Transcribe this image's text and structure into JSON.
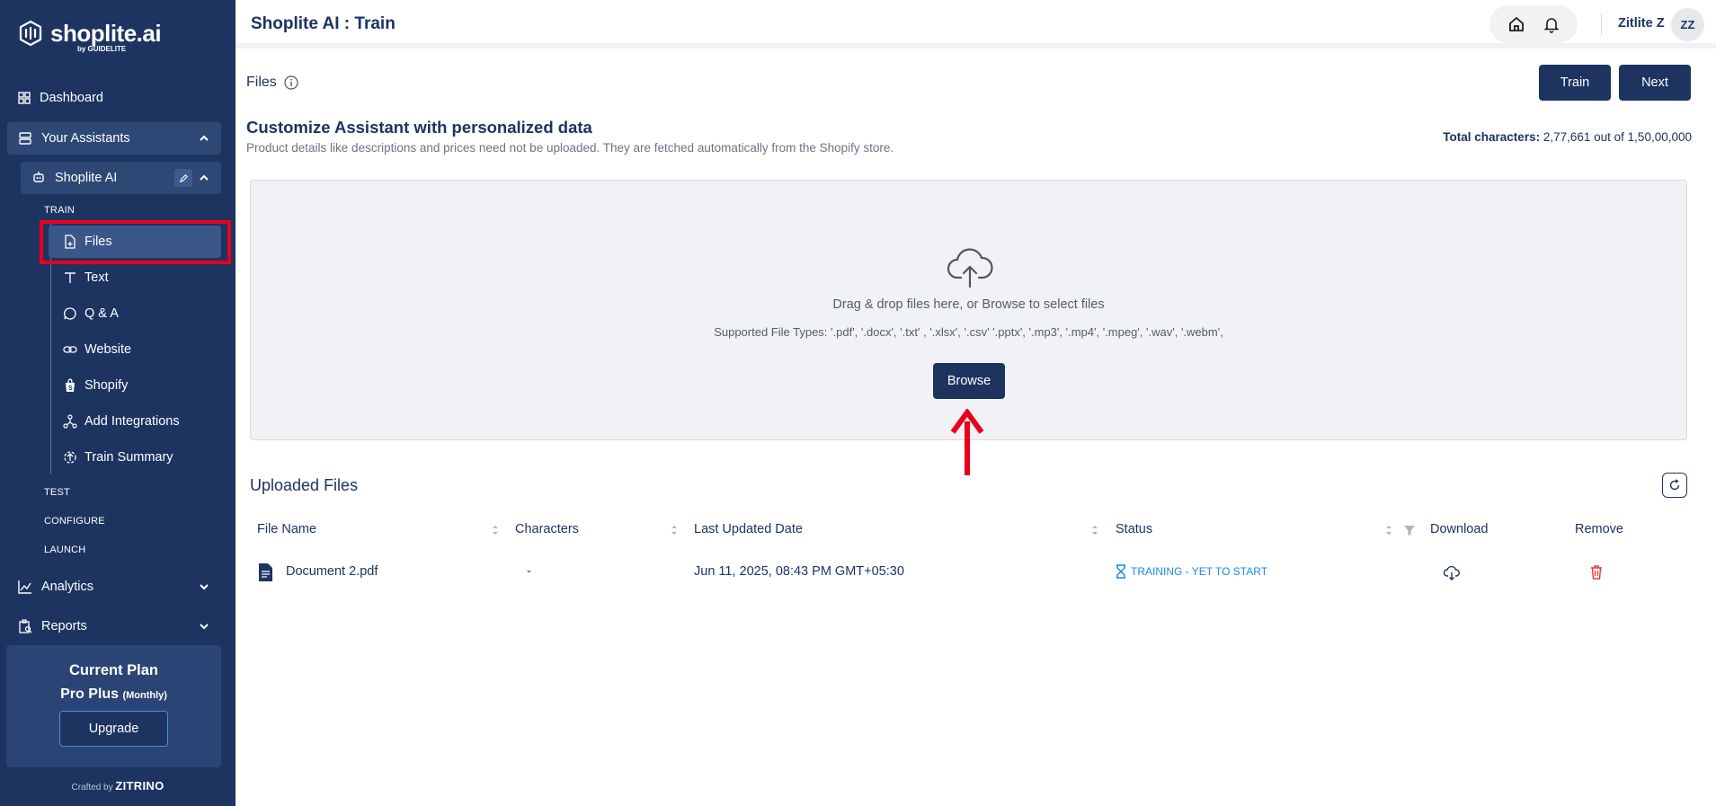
{
  "sidebar": {
    "logo_text": "shoplite.ai",
    "logo_sub": "by GUIDELITE",
    "dashboard": "Dashboard",
    "your_assistants": "Your Assistants",
    "assistant_name": "Shoplite AI",
    "sections": {
      "train": "TRAIN",
      "test": "TEST",
      "configure": "CONFIGURE",
      "launch": "LAUNCH"
    },
    "train_items": [
      "Files",
      "Text",
      "Q & A",
      "Website",
      "Shopify",
      "Add Integrations",
      "Train Summary"
    ],
    "analytics": "Analytics",
    "reports": "Reports",
    "plan": {
      "title": "Current Plan",
      "name": "Pro Plus",
      "period": "(Monthly)",
      "upgrade_label": "Upgrade"
    },
    "crafted_by": "Crafted by",
    "crafted_brand": "ZITRINO"
  },
  "header": {
    "title": "Shoplite AI : Train",
    "user_name": "Zitlite Z",
    "avatar_initials": "ZZ"
  },
  "main": {
    "files_heading": "Files",
    "train_button": "Train",
    "next_button": "Next",
    "customize_title": "Customize Assistant with personalized data",
    "customize_subtitle": "Product details like descriptions and prices need not be uploaded. They are fetched automatically from the Shopify store.",
    "total_chars_label": "Total characters:",
    "total_chars_value": "2,77,661 out of 1,50,00,000",
    "dropzone": {
      "instruction": "Drag & drop files here, or Browse to select files",
      "supported": "Supported File Types: '.pdf', '.docx', '.txt' , '.xlsx', '.csv' '.pptx', '.mp3', '.mp4', '.mpeg', '.wav', '.webm',",
      "browse_label": "Browse"
    },
    "uploaded_title": "Uploaded Files",
    "table": {
      "headers": [
        "File Name",
        "Characters",
        "Last Updated Date",
        "Status",
        "Download",
        "Remove"
      ],
      "rows": [
        {
          "file_name": "Document 2.pdf",
          "characters": "-",
          "last_updated": "Jun 11, 2025, 08:43 PM GMT+05:30",
          "status": "TRAINING - YET TO START"
        }
      ]
    }
  },
  "colors": {
    "sidebar_bg": "#1d3461",
    "accent_dark": "#1d3461",
    "status_blue": "#1e88e5",
    "remove_red": "#e53935",
    "annotation_red": "#e8001c"
  },
  "icons": [
    "logo-icon",
    "dashboard-icon",
    "assistants-icon",
    "chevron-up-icon",
    "bot-icon",
    "edit-icon",
    "file-add-icon",
    "text-icon",
    "chat-icon",
    "link-icon",
    "shopify-icon",
    "integrations-icon",
    "summary-icon",
    "analytics-icon",
    "reports-icon",
    "chevron-down-icon",
    "home-icon",
    "bell-icon",
    "info-icon",
    "cloud-upload-icon",
    "refresh-icon",
    "sort-icon",
    "filter-icon",
    "pdf-file-icon",
    "hourglass-icon",
    "download-icon",
    "trash-icon"
  ]
}
